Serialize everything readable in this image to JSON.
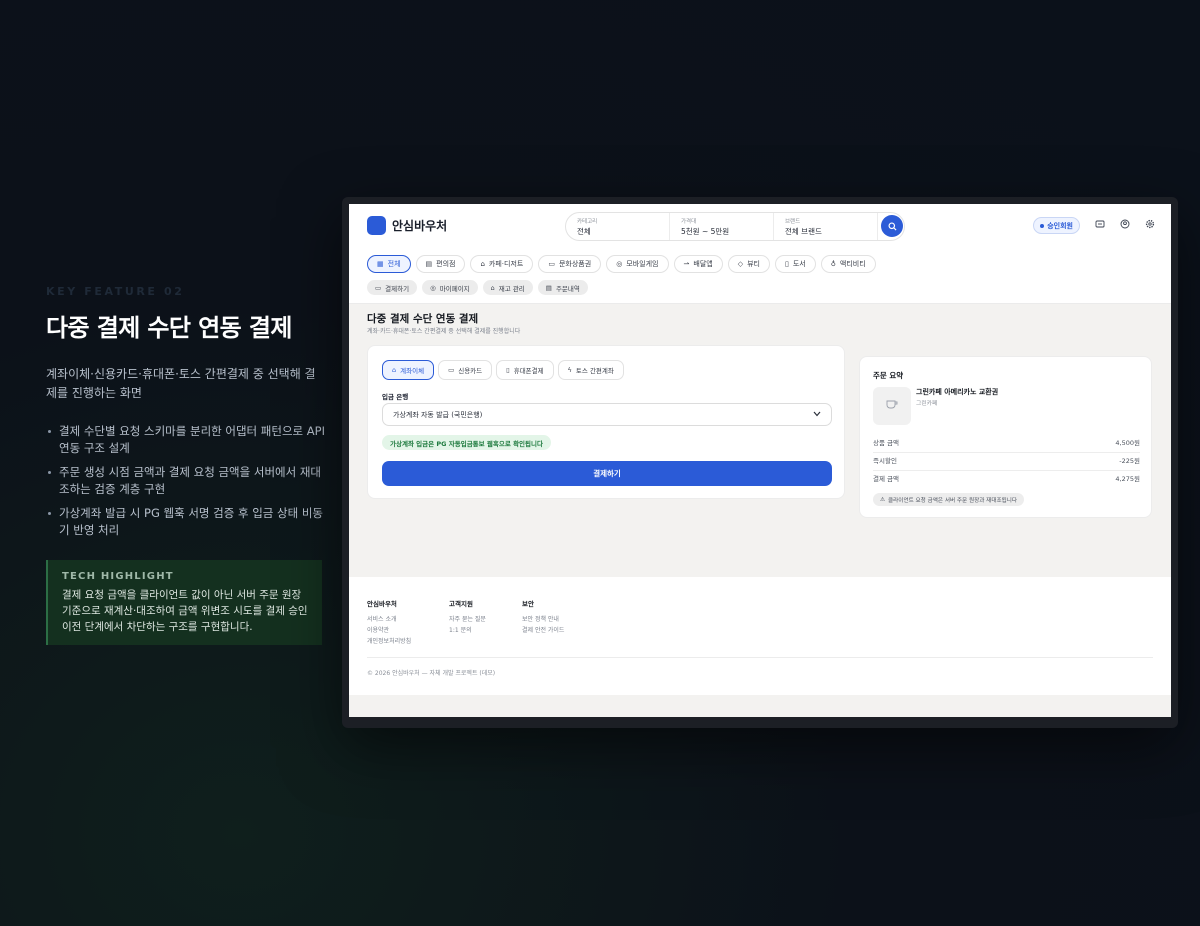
{
  "left": {
    "kicker": "KEY FEATURE 02",
    "title": "다중 결제 수단 연동 결제",
    "description": "계좌이체·신용카드·휴대폰·토스 간편결제 중 선택해 결제를 진행하는 화면",
    "bullets": [
      "결제 수단별 요청 스키마를 분리한 어댑터 패턴으로 API 연동 구조 설계",
      "주문 생성 시점 금액과 결제 요청 금액을 서버에서 재대조하는 검증 계층 구현",
      "가상계좌 발급 시 PG 웹훅 서명 검증 후 입금 상태 비동기 반영 처리"
    ],
    "tech_title": "TECH HIGHLIGHT",
    "tech_body": "결제 요청 금액을 클라이언트 값이 아닌 서버 주문 원장 기준으로 재계산·대조하여 금액 위변조 시도를 결제 승인 이전 단계에서 차단하는 구조를 구현합니다."
  },
  "app": {
    "brand": "안심바우처",
    "search": {
      "category_label": "카테고리",
      "category_value": "전체",
      "price_label": "가격대",
      "price_value": "5천원 ~ 5만원",
      "brand_label": "브랜드",
      "brand_value": "전체 브랜드"
    },
    "member_badge": "승인회원",
    "categories": [
      "전체",
      "편의점",
      "카페·디저트",
      "문화상품권",
      "모바일게임",
      "배달앱",
      "뷰티",
      "도서",
      "액티비티"
    ],
    "subnav": [
      "결제하기",
      "마이페이지",
      "재고 관리",
      "주문내역"
    ],
    "page_title": "다중 결제 수단 연동 결제",
    "page_subtitle": "계좌·카드·휴대폰·토스 간편결제 중 선택해 결제를 진행합니다",
    "pay_tabs": [
      "계좌이체",
      "신용카드",
      "휴대폰결제",
      "토스 간편계좌"
    ],
    "bank_label": "입금 은행",
    "bank_selected": "가상계좌 자동 발급 (국민은행)",
    "notice": "가상계좌 입금은 PG 자동입금통보 웹훅으로 확인됩니다",
    "pay_button": "결제하기",
    "summary": {
      "title": "주문 요약",
      "product_name": "그린카페 아메리카노 교환권",
      "product_brand": "그린카페",
      "rows": [
        {
          "label": "상품 금액",
          "value": "4,500원"
        },
        {
          "label": "즉시할인",
          "value": "-225원"
        },
        {
          "label": "결제 금액",
          "value": "4,275원"
        }
      ],
      "guard_note": "클라이언트 요청 금액은 서버 주문 원장과 재대조됩니다"
    },
    "footer": {
      "cols": [
        {
          "head": "안심바우처",
          "links": [
            "서비스 소개",
            "이용약관",
            "개인정보처리방침"
          ]
        },
        {
          "head": "고객지원",
          "links": [
            "자주 묻는 질문",
            "1:1 문의"
          ]
        },
        {
          "head": "보안",
          "links": [
            "보안 정책 안내",
            "결제 안전 가이드"
          ]
        }
      ],
      "copyright": "© 2026 안심바우처 — 자체 개발 프로젝트 (데모)"
    }
  },
  "colors": {
    "accent": "#2b5bd7",
    "success": "#1d7a3e",
    "background": "#0b111a"
  }
}
